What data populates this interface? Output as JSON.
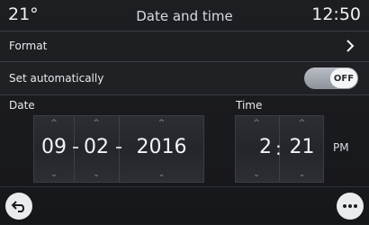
{
  "status": {
    "temperature": "21°",
    "title": "Date and time",
    "clock": "12:50"
  },
  "format": {
    "label": "Format"
  },
  "auto": {
    "label": "Set automatically",
    "toggle_state": "OFF"
  },
  "date": {
    "label": "Date",
    "month": "09",
    "day": "02",
    "year": "2016"
  },
  "time": {
    "label": "Time",
    "hour": "2",
    "minute": "21",
    "ampm": "PM"
  },
  "icons": {
    "up": "^",
    "down": "⌄"
  },
  "colors": {
    "toggle_track": "#a4a8b0",
    "background": "#1a1b1e"
  }
}
